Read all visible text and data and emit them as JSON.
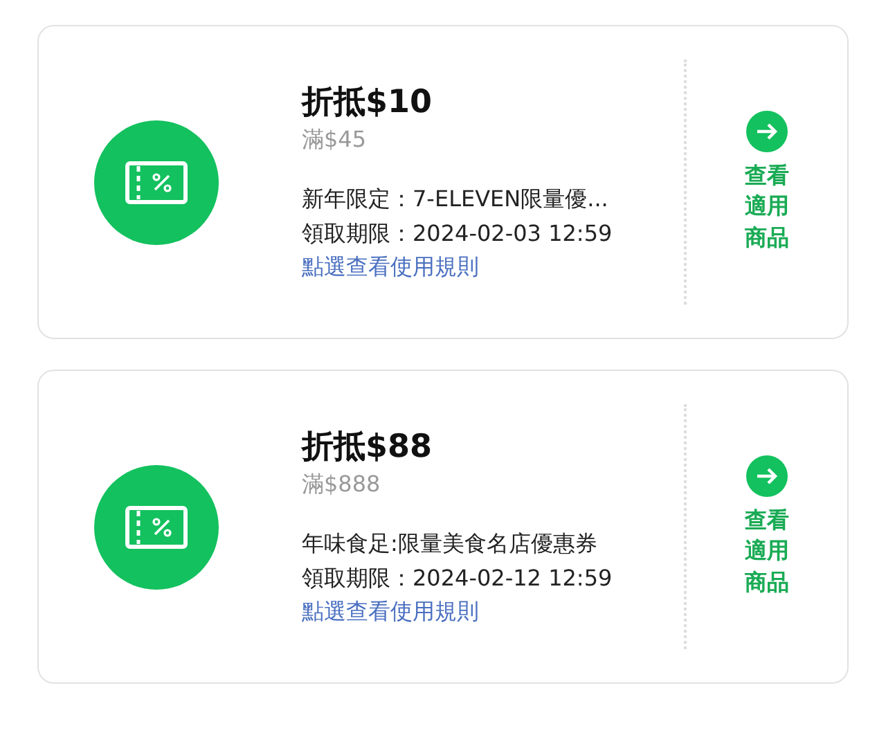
{
  "coupons": [
    {
      "title": "折抵$10",
      "minimum": "滿$45",
      "name": "新年限定：7-ELEVEN限量優...",
      "deadline": "領取期限：2024-02-03 12:59",
      "rules_link": "點選查看使用規則",
      "action": "查看適用商品"
    },
    {
      "title": "折抵$88",
      "minimum": "滿$888",
      "name": "年味食足:限量美食名店優惠券",
      "deadline": "領取期限：2024-02-12 12:59",
      "rules_link": "點選查看使用規則",
      "action": "查看適用商品"
    }
  ]
}
